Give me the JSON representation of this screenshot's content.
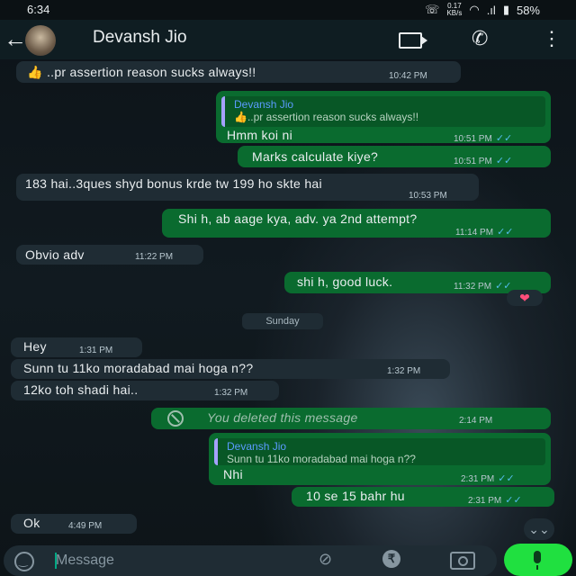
{
  "status_bar": {
    "time": "6:34",
    "kbs_value": "0.17",
    "kbs_unit": "KB/s",
    "battery": "58%"
  },
  "header": {
    "contact_name": "Devansh Jio"
  },
  "messages": [
    {
      "dir": "in",
      "text": "..pr assertion reason sucks always!!",
      "time": "10:42 PM",
      "emoji": "👍"
    },
    {
      "dir": "out",
      "quote_name": "Devansh Jio",
      "quote_text": "..pr assertion reason sucks always!!",
      "quote_emoji": "👍",
      "text": "Hmm koi ni",
      "time": "10:51 PM"
    },
    {
      "dir": "out",
      "text": "Marks calculate kiye?",
      "time": "10:51 PM"
    },
    {
      "dir": "in",
      "text": "183 hai..3ques shyd bonus krde tw 199 ho skte hai",
      "time": "10:53 PM"
    },
    {
      "dir": "out",
      "text": "Shi h, ab aage kya, adv. ya 2nd attempt?",
      "time": "11:14 PM"
    },
    {
      "dir": "in",
      "text": "Obvio adv",
      "time": "11:22 PM"
    },
    {
      "dir": "out",
      "text": "shi h, good luck.",
      "time": "11:32 PM"
    },
    {
      "dir": "in",
      "text": "Hey",
      "time": "1:31 PM"
    },
    {
      "dir": "in",
      "text": "Sunn tu 11ko moradabad mai hoga n??",
      "time": "1:32 PM"
    },
    {
      "dir": "in",
      "text": "12ko toh shadi hai..",
      "time": "1:32 PM"
    },
    {
      "dir": "out",
      "text": "You deleted this message",
      "time": "2:14 PM"
    },
    {
      "dir": "out",
      "quote_name": "Devansh Jio",
      "quote_text": "Sunn tu 11ko moradabad mai hoga n??",
      "text": "Nhi",
      "time": "2:31 PM"
    },
    {
      "dir": "out",
      "text": "10 se 15 bahr hu",
      "time": "2:31 PM"
    },
    {
      "dir": "in",
      "text": "Ok",
      "time": "4:49 PM"
    }
  ],
  "date_chip": "Sunday",
  "reaction": "❤",
  "ticks": "✓✓",
  "input": {
    "placeholder": "Message"
  },
  "colors": {
    "incoming": "#1f2c34",
    "outgoing": "#0a6b2f",
    "mic": "#20e040",
    "read_ticks": "#53bdeb"
  }
}
